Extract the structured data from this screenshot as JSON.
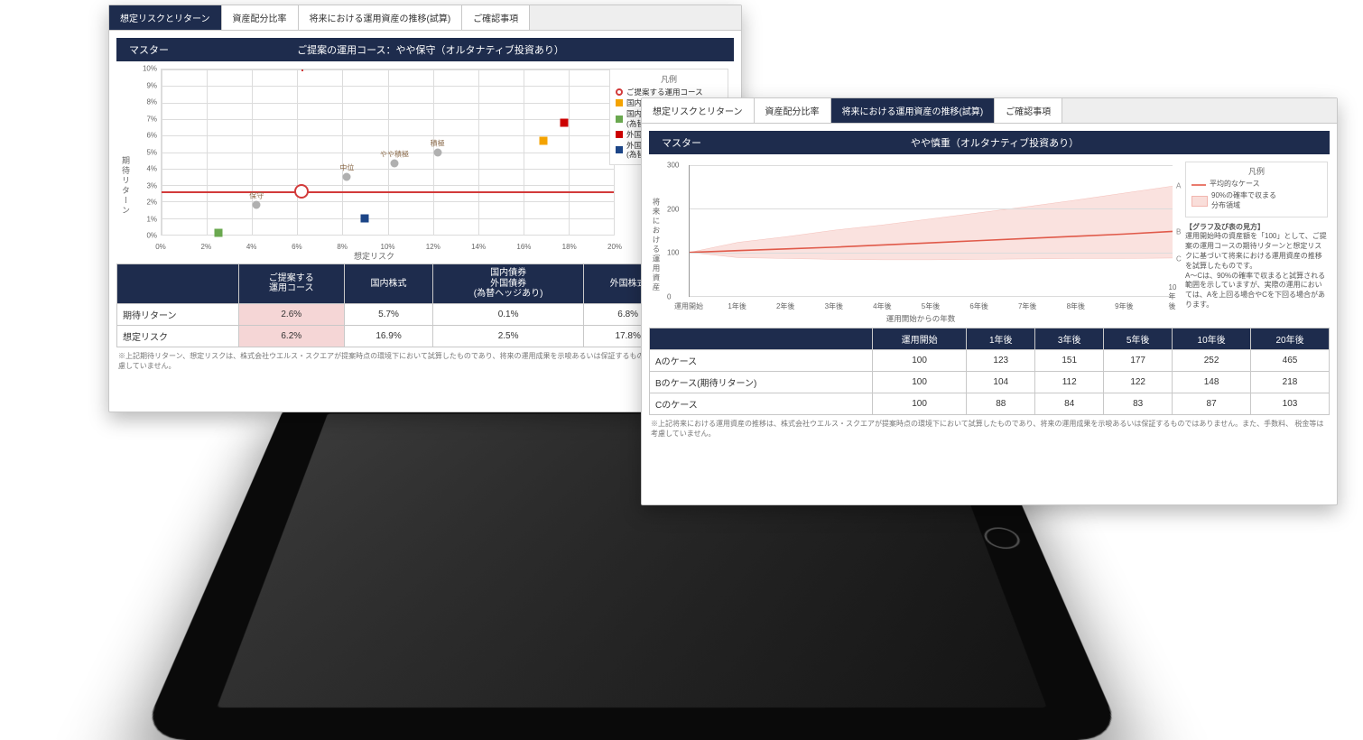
{
  "left": {
    "tabs": [
      "想定リスクとリターン",
      "資産配分比率",
      "将来における運用資産の推移(試算)",
      "ご確認事項"
    ],
    "active_tab_index": 0,
    "titlebar_label": "マスター",
    "titlebar_value": "ご提案の運用コース：やや保守（オルタナティブ投資あり）",
    "y_axis_label": "期待リターン",
    "x_axis_label": "想定リスク",
    "legend_title": "凡例",
    "legend": [
      {
        "label": "ご提案する運用コース",
        "swatch": "ring",
        "color": "#d23a3a"
      },
      {
        "label": "国内株式",
        "swatch": "square",
        "color": "#f4a300"
      },
      {
        "label": "国内債券・外国債券\n(為替ヘッジあり)",
        "swatch": "square",
        "color": "#6aa84f"
      },
      {
        "label": "外国株式",
        "swatch": "square",
        "color": "#cc0000"
      },
      {
        "label": "外国債券\n(為替ヘッジなし)",
        "swatch": "square",
        "color": "#1c4587"
      }
    ],
    "table": {
      "cols": [
        "",
        "ご提案する\n運用コース",
        "国内株式",
        "国内債券\n外国債券\n(為替ヘッジあり)",
        "外国株式"
      ],
      "rows": [
        {
          "hdr": "期待リターン",
          "cells": [
            "2.6%",
            "5.7%",
            "0.1%",
            "6.8%"
          ],
          "hl_col": 0
        },
        {
          "hdr": "想定リスク",
          "cells": [
            "6.2%",
            "16.9%",
            "2.5%",
            "17.8%"
          ],
          "hl_col": 0
        }
      ],
      "trailing_hdr": "(為替"
    },
    "footnote": "※上記期待リターン、想定リスクは、株式会社ウエルス・スクエアが提案時点の環境下において試算したものであり、将来の運用成果を示唆あるいは保証するものではありません。\n等は考慮していません。"
  },
  "right": {
    "tabs": [
      "想定リスクとリターン",
      "資産配分比率",
      "将来における運用資産の推移(試算)",
      "ご確認事項"
    ],
    "active_tab_index": 2,
    "titlebar_label": "マスター",
    "titlebar_value": "やや慎重（オルタナティブ投資あり）",
    "y_axis_label": "将来における運用資産",
    "x_axis_label": "運用開始からの年数",
    "legend_title": "凡例",
    "legend_line": "平均的なケース",
    "legend_area": "90%の確率で収まる\n分布領域",
    "side_title": "【グラフ及び表の見方】",
    "side_body": "運用開始時の資産額を「100」として、ご提案の運用コースの期待リターンと想定リスクに基づいて将来における運用資産の推移を試算したものです。\nA〜Cは、90%の確率で収まると試算される範囲を示していますが、実際の運用においては、Aを上回る場合やCを下回る場合があります。",
    "end_labels": [
      "A",
      "B",
      "C"
    ],
    "table": {
      "cols": [
        "",
        "運用開始",
        "1年後",
        "3年後",
        "5年後",
        "10年後",
        "20年後"
      ],
      "rows": [
        {
          "hdr": "Aのケース",
          "cells": [
            "100",
            "123",
            "151",
            "177",
            "252",
            "465"
          ]
        },
        {
          "hdr": "Bのケース(期待リターン)",
          "cells": [
            "100",
            "104",
            "112",
            "122",
            "148",
            "218"
          ]
        },
        {
          "hdr": "Cのケース",
          "cells": [
            "100",
            "88",
            "84",
            "83",
            "87",
            "103"
          ]
        }
      ]
    },
    "footnote": "※上記将来における運用資産の推移は、株式会社ウエルス・スクエアが提案時点の環境下において試算したものであり、将来の運用成果を示唆あるいは保証するものではありません。また、手数料、\n税金等は考慮していません。"
  },
  "chart_data": [
    {
      "type": "scatter",
      "title": "想定リスクとリターン",
      "xlabel": "想定リスク",
      "ylabel": "期待リターン",
      "xlim": [
        0,
        20
      ],
      "ylim": [
        0,
        10
      ],
      "x_ticks": [
        0,
        2,
        4,
        6,
        8,
        10,
        12,
        14,
        16,
        18,
        20
      ],
      "y_ticks": [
        0,
        1,
        2,
        3,
        4,
        5,
        6,
        7,
        8,
        9,
        10
      ],
      "reference_lines": {
        "x": 6.2,
        "y": 2.6
      },
      "series": [
        {
          "name": "ご提案する運用コース",
          "shape": "ring",
          "color": "#d23a3a",
          "points": [
            {
              "x": 6.2,
              "y": 2.6
            }
          ]
        },
        {
          "name": "国内株式",
          "shape": "square",
          "color": "#f4a300",
          "points": [
            {
              "x": 16.9,
              "y": 5.7
            }
          ]
        },
        {
          "name": "国内債券・外国債券(為替ヘッジあり)",
          "shape": "square",
          "color": "#6aa84f",
          "points": [
            {
              "x": 2.5,
              "y": 0.1
            }
          ]
        },
        {
          "name": "外国株式",
          "shape": "square",
          "color": "#cc0000",
          "points": [
            {
              "x": 17.8,
              "y": 6.8
            }
          ]
        },
        {
          "name": "外国債券(為替ヘッジなし)",
          "shape": "square",
          "color": "#1c4587",
          "points": [
            {
              "x": 9.0,
              "y": 1.0
            }
          ]
        },
        {
          "name": "保守",
          "shape": "circle",
          "color": "#b0b0b0",
          "points": [
            {
              "x": 4.2,
              "y": 1.8
            }
          ],
          "label": "保守"
        },
        {
          "name": "中位",
          "shape": "circle",
          "color": "#b0b0b0",
          "points": [
            {
              "x": 8.2,
              "y": 3.5
            }
          ],
          "label": "中位"
        },
        {
          "name": "やや積極",
          "shape": "circle",
          "color": "#b0b0b0",
          "points": [
            {
              "x": 10.3,
              "y": 4.3
            }
          ],
          "label": "やや積極"
        },
        {
          "name": "積極",
          "shape": "circle",
          "color": "#b0b0b0",
          "points": [
            {
              "x": 12.2,
              "y": 5.0
            }
          ],
          "label": "積極"
        }
      ]
    },
    {
      "type": "area",
      "title": "将来における運用資産の推移(試算)",
      "xlabel": "運用開始からの年数",
      "ylabel": "将来における運用資産",
      "index_base": 100,
      "x_ticks": [
        "運用開始",
        "1年後",
        "2年後",
        "3年後",
        "4年後",
        "5年後",
        "6年後",
        "7年後",
        "8年後",
        "9年後",
        "10年後"
      ],
      "ylim": [
        0,
        300
      ],
      "y_ticks": [
        0,
        100,
        200,
        300
      ],
      "series": [
        {
          "name": "Aのケース(上限90%)",
          "role": "upper",
          "values": [
            100,
            123,
            136,
            151,
            163,
            177,
            191,
            205,
            220,
            236,
            252
          ]
        },
        {
          "name": "Bのケース(期待リターン)",
          "role": "mean",
          "values": [
            100,
            104,
            108,
            112,
            117,
            122,
            127,
            132,
            137,
            142,
            148
          ]
        },
        {
          "name": "Cのケース(下限90%)",
          "role": "lower",
          "values": [
            100,
            88,
            86,
            84,
            83,
            83,
            84,
            85,
            86,
            86,
            87
          ]
        }
      ]
    }
  ]
}
